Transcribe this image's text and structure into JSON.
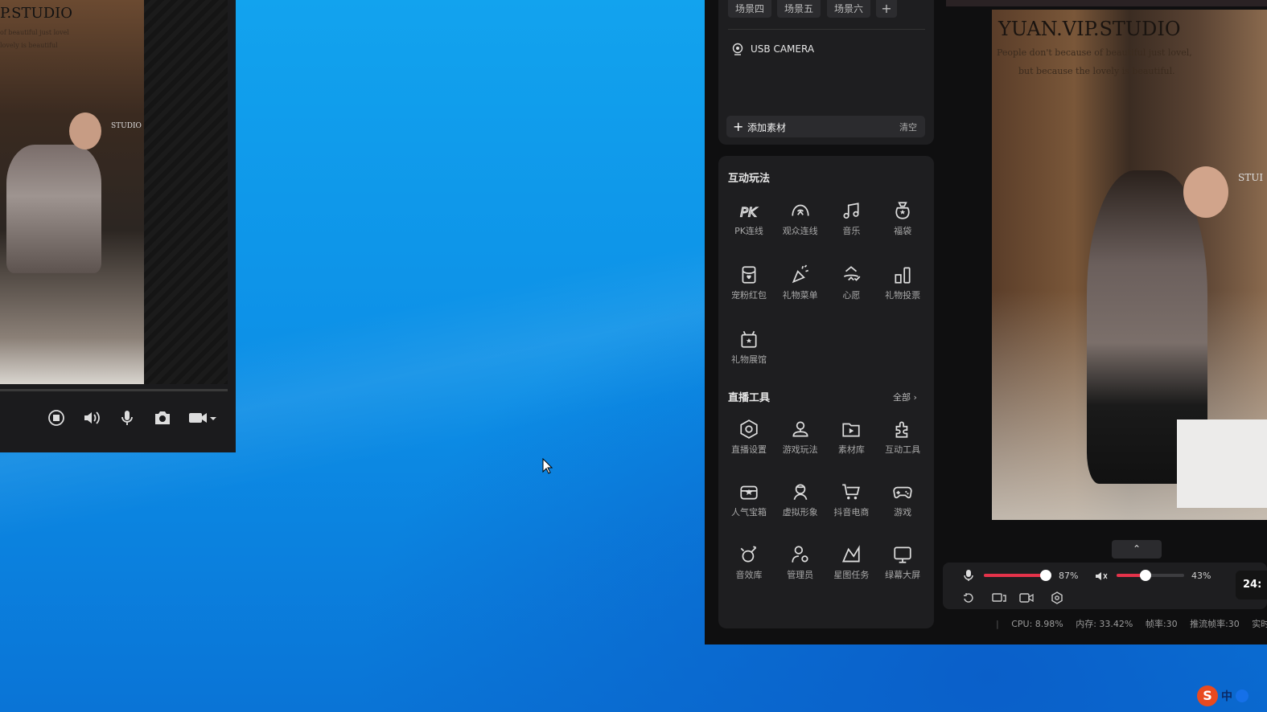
{
  "left_window": {
    "watermark": "P.STUDIO",
    "sub1": "of beautiful just lovel",
    "sub2": "lovely is beautiful",
    "studio_tag": "STUDIO",
    "controls": [
      "stop-icon",
      "speaker-icon",
      "microphone-icon",
      "camera-icon",
      "video-camera-icon"
    ]
  },
  "scenes": {
    "tabs": [
      "场景四",
      "场景五",
      "场景六"
    ],
    "add_label": "+"
  },
  "sources": {
    "usb_camera": "USB CAMERA",
    "add_material": "添加素材",
    "clear": "清空"
  },
  "interactive": {
    "title": "互动玩法",
    "items": [
      {
        "label": "PK连线",
        "icon": "pk-icon"
      },
      {
        "label": "观众连线",
        "icon": "audience-link-icon"
      },
      {
        "label": "音乐",
        "icon": "music-icon"
      },
      {
        "label": "福袋",
        "icon": "lucky-bag-icon"
      },
      {
        "label": "宠粉红包",
        "icon": "red-packet-icon"
      },
      {
        "label": "礼物菜单",
        "icon": "gift-menu-icon"
      },
      {
        "label": "心愿",
        "icon": "wish-icon"
      },
      {
        "label": "礼物投票",
        "icon": "gift-vote-icon"
      },
      {
        "label": "礼物展馆",
        "icon": "gift-gallery-icon"
      }
    ]
  },
  "live_tools": {
    "title": "直播工具",
    "all_label": "全部",
    "items": [
      {
        "label": "直播设置",
        "icon": "live-settings-icon"
      },
      {
        "label": "游戏玩法",
        "icon": "game-play-icon"
      },
      {
        "label": "素材库",
        "icon": "material-library-icon"
      },
      {
        "label": "互动工具",
        "icon": "interactive-tools-icon"
      },
      {
        "label": "人气宝箱",
        "icon": "popularity-box-icon"
      },
      {
        "label": "虚拟形象",
        "icon": "avatar-icon"
      },
      {
        "label": "抖音电商",
        "icon": "shop-cart-icon"
      },
      {
        "label": "游戏",
        "icon": "gamepad-icon"
      },
      {
        "label": "音效库",
        "icon": "sound-effects-icon"
      },
      {
        "label": "管理员",
        "icon": "admin-icon"
      },
      {
        "label": "星图任务",
        "icon": "star-task-icon"
      },
      {
        "label": "绿幕大屏",
        "icon": "green-screen-icon"
      }
    ]
  },
  "preview": {
    "title": "YUAN.VIP.STUDIO",
    "line1": "People don't because of beautiful just lovel,",
    "line2": "but because the lovely is beautiful.",
    "side_tag": "STUI"
  },
  "audio": {
    "mic_percent": "87%",
    "mic_level": 0.87,
    "speaker_percent": "43%",
    "speaker_level": 0.43,
    "timer": "24:"
  },
  "status": {
    "cpu": "CPU: 8.98%",
    "mem": "内存: 33.42%",
    "fps": "帧率:30",
    "push_fps": "推流帧率:30",
    "realtime": "实时码"
  },
  "taskbar": {
    "ime_logo": "S",
    "ime_lang": "中"
  },
  "colors": {
    "accent": "#e5334a",
    "panel": "#1e1e20",
    "desktop": "#0c8ee6"
  }
}
